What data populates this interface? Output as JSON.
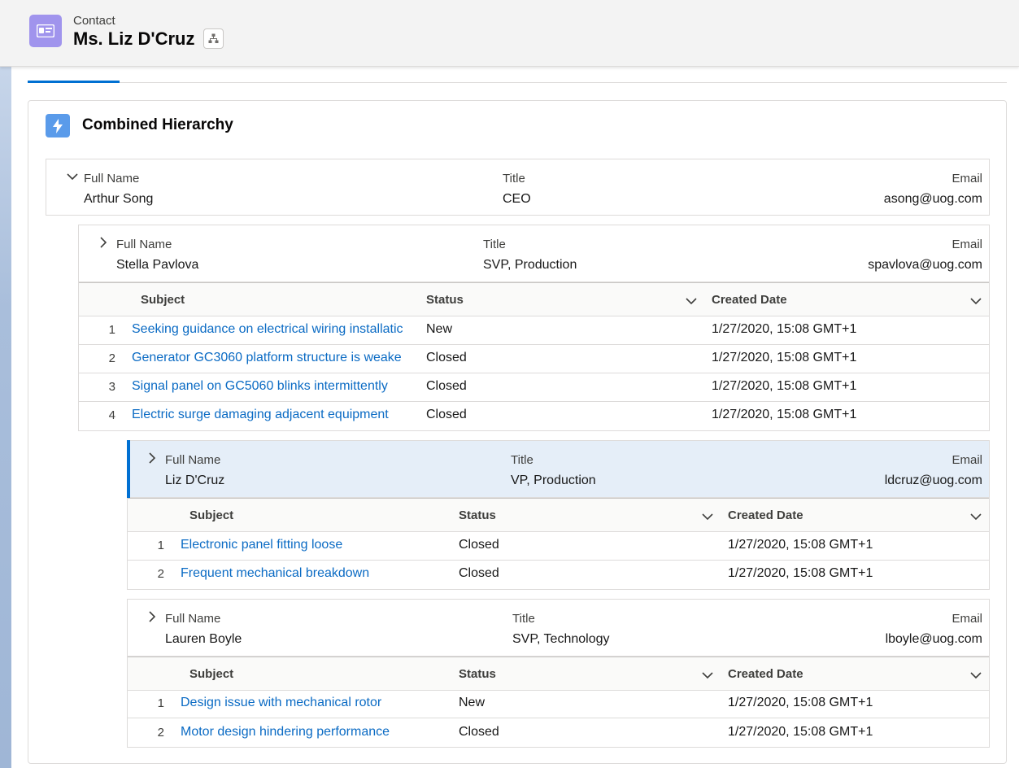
{
  "header": {
    "object_type": "Contact",
    "record_name": "Ms. Liz D'Cruz",
    "icon": "contact-card-icon",
    "hierarchy_icon": "hierarchy-icon"
  },
  "card": {
    "title": "Combined Hierarchy",
    "icon": "lightning-icon"
  },
  "colors": {
    "accent": "#0070d2",
    "link": "#0b6bc4",
    "contact_icon_bg": "#a094ed",
    "card_icon_bg": "#5a9bea",
    "selected_row_bg": "#e5eef8"
  },
  "field_labels": {
    "full_name": "Full Name",
    "title": "Title",
    "email": "Email"
  },
  "grid_headers": {
    "subject": "Subject",
    "status": "Status",
    "created_date": "Created Date"
  },
  "nodes": [
    {
      "full_name": "Arthur Song",
      "title": "CEO",
      "email": "asong@uog.com",
      "expanded": true,
      "cases": []
    },
    {
      "full_name": "Stella Pavlova",
      "title": "SVP, Production",
      "email": "spavlova@uog.com",
      "expanded": false,
      "cases": [
        {
          "num": "1",
          "subject": "Seeking guidance on electrical wiring installatic",
          "status": "New",
          "created": "1/27/2020, 15:08 GMT+1"
        },
        {
          "num": "2",
          "subject": "Generator GC3060 platform structure is weake",
          "status": "Closed",
          "created": "1/27/2020, 15:08 GMT+1"
        },
        {
          "num": "3",
          "subject": "Signal panel on GC5060 blinks intermittently",
          "status": "Closed",
          "created": "1/27/2020, 15:08 GMT+1"
        },
        {
          "num": "4",
          "subject": "Electric surge damaging adjacent equipment",
          "status": "Closed",
          "created": "1/27/2020, 15:08 GMT+1"
        }
      ]
    },
    {
      "full_name": "Liz D'Cruz",
      "title": "VP, Production",
      "email": "ldcruz@uog.com",
      "expanded": false,
      "selected": true,
      "cases": [
        {
          "num": "1",
          "subject": "Electronic panel fitting loose",
          "status": "Closed",
          "created": "1/27/2020, 15:08 GMT+1"
        },
        {
          "num": "2",
          "subject": "Frequent mechanical breakdown",
          "status": "Closed",
          "created": "1/27/2020, 15:08 GMT+1"
        }
      ]
    },
    {
      "full_name": "Lauren Boyle",
      "title": "SVP, Technology",
      "email": "lboyle@uog.com",
      "expanded": false,
      "cases": [
        {
          "num": "1",
          "subject": "Design issue with mechanical rotor",
          "status": "New",
          "created": "1/27/2020, 15:08 GMT+1"
        },
        {
          "num": "2",
          "subject": "Motor design hindering performance",
          "status": "Closed",
          "created": "1/27/2020, 15:08 GMT+1"
        }
      ]
    }
  ]
}
